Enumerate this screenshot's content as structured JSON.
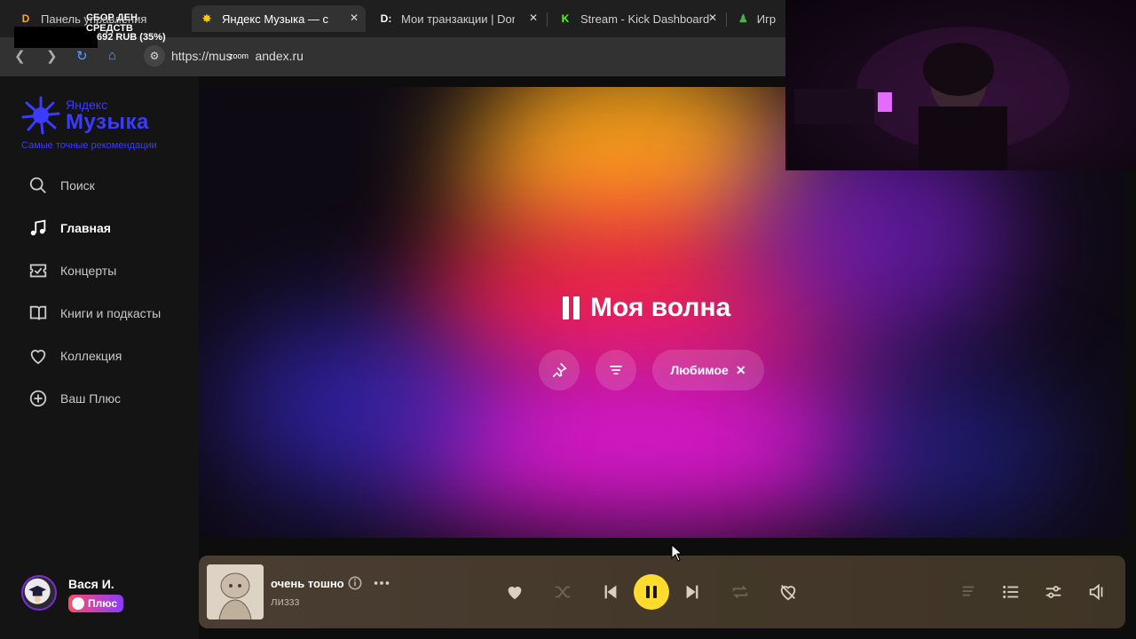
{
  "browser": {
    "tabs": [
      {
        "title": "Панель управления",
        "favicon": "D",
        "favicon_color": "#f5a623"
      },
      {
        "title": "Яндекс Музыка — с",
        "favicon": "✸",
        "favicon_color": "#ffcc00"
      },
      {
        "title": "Мои транзакции | Dona",
        "favicon": "D:",
        "favicon_color": "#ffffff"
      },
      {
        "title": "Stream - Kick Dashboard",
        "favicon": "K",
        "favicon_color": "#53fc18"
      },
      {
        "title": "Играт",
        "favicon": "♟",
        "favicon_color": "#4caf50"
      }
    ],
    "url": "https://music.yandex.ru",
    "url_display": "https://mus",
    "url_suffix": "andex.ru",
    "url_overlay_text": "zoom"
  },
  "donation_widget": {
    "title": "СБОР ДЕН СРЕДСТВ",
    "amount": "692 RUB (35%)",
    "progress_percent": 35
  },
  "sidebar": {
    "logo_yandex": "Яндекс",
    "logo_music": "Музыка",
    "tagline": "Самые точные рекомендации",
    "items": [
      {
        "label": "Поиск",
        "icon": "search-icon"
      },
      {
        "label": "Главная",
        "icon": "music-note-icon",
        "active": true
      },
      {
        "label": "Концерты",
        "icon": "ticket-icon"
      },
      {
        "label": "Книги и подкасты",
        "icon": "book-icon"
      },
      {
        "label": "Коллекция",
        "icon": "heart-icon"
      },
      {
        "label": "Ваш Плюс",
        "icon": "plus-circle-icon"
      }
    ],
    "user": {
      "name": "Вася И.",
      "badge": "Плюс"
    }
  },
  "hero": {
    "title": "Моя волна",
    "filter_chip": "Любимое",
    "colors": {
      "top": "#f7a21b",
      "mid": "#ff1f4b",
      "bottom": "#e21ad6",
      "side": "#3a2bd9"
    }
  },
  "player": {
    "track_title": "очень тошно",
    "artist": "лиззз",
    "accent": "#ffdb2d"
  }
}
